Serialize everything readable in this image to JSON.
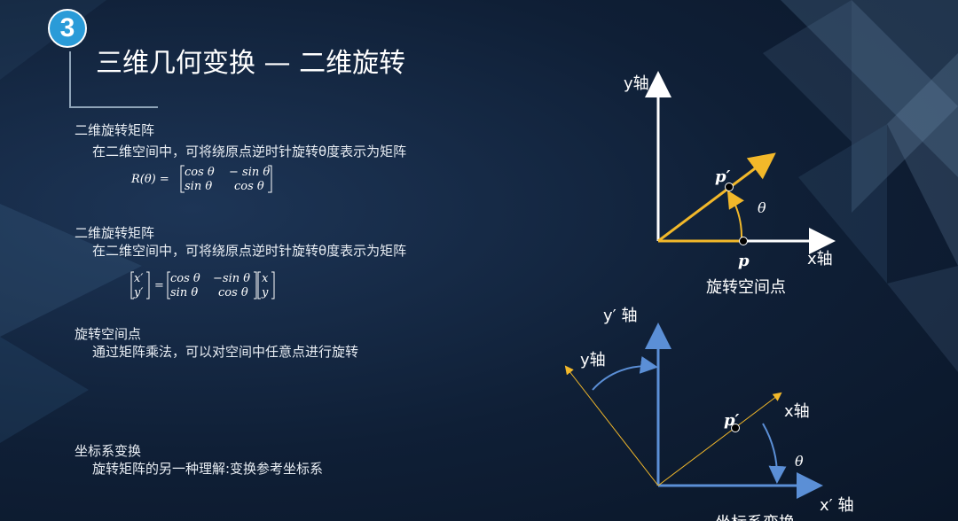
{
  "slide": {
    "badge_number": "3",
    "title": "三维几何变换 — 二维旋转"
  },
  "sections": [
    {
      "heading": "二维旋转矩阵",
      "line": "在二维空间中，可将绕原点逆时针旋转θ度表示为矩阵",
      "formula": {
        "lhs": "R(θ) =",
        "row1": [
          "cos θ",
          "− sin θ"
        ],
        "row2": [
          "sin θ",
          "cos θ"
        ]
      }
    },
    {
      "heading": "二维旋转矩阵",
      "line": "在二维空间中，可将绕原点逆时针旋转θ度表示为矩阵",
      "formula": {
        "vec_out": [
          "x′",
          "y′"
        ],
        "eq": "=",
        "row1": [
          "cos θ",
          "−sin θ"
        ],
        "row2": [
          "sin θ",
          "cos θ"
        ],
        "vec_in": [
          "x",
          "y"
        ]
      }
    },
    {
      "heading": "旋转空间点",
      "line": "通过矩阵乘法，可以对空间中任意点进行旋转"
    },
    {
      "heading": "坐标系变换",
      "line": "旋转矩阵的另一种理解:变换参考坐标系"
    }
  ],
  "diagram_top": {
    "y_axis_label": "y轴",
    "x_axis_label": "x轴",
    "point_rotated": "p′",
    "point_original": "p",
    "angle": "θ",
    "caption": "旋转空间点"
  },
  "diagram_bottom": {
    "y_prime_label": "y′  轴",
    "x_prime_label": "x′  轴",
    "y_label": "y轴",
    "x_label": "x轴",
    "point": "p′",
    "angle": "θ",
    "caption_partial": "坐标系变换"
  },
  "colors": {
    "badge": "#2a9bd8",
    "arrow_white": "#ffffff",
    "vector_yellow": "#f2b82a",
    "axis_blue": "#5b8fd6",
    "background": "#0f1f36"
  }
}
